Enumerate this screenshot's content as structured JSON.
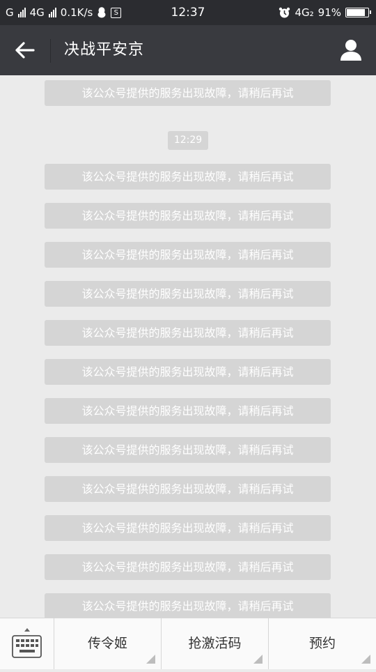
{
  "status_bar": {
    "carrier1": "G",
    "carrier2": "4G",
    "net_speed": "0.1K/s",
    "s_icon_text": "S",
    "time": "12:37",
    "network": "4G₂",
    "battery": "91%",
    "battery_level": 0.91
  },
  "header": {
    "title": "决战平安京"
  },
  "chat": {
    "error_text": "该公众号提供的服务出现故障，请稍后再试",
    "timestamp": "12:29",
    "messages_before": 1,
    "messages_after": 12
  },
  "menu": {
    "items": [
      {
        "label": "传令姬"
      },
      {
        "label": "抢激活码"
      },
      {
        "label": "预约"
      }
    ]
  },
  "colors": {
    "statusbar_bg": "#2b2c30",
    "titlebar_bg": "#393a3f",
    "chat_bg": "#ebebeb",
    "bubble_bg": "#d5d5d5"
  }
}
